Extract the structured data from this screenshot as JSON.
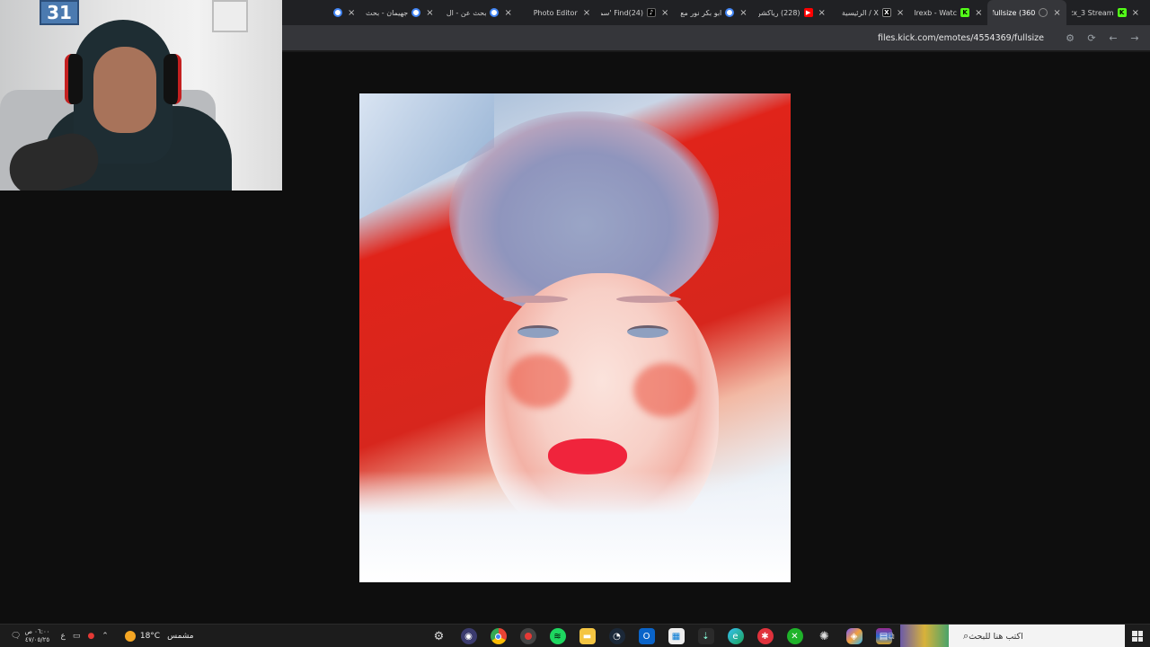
{
  "browser": {
    "tabs": [
      {
        "title": "rzx_3 Stream",
        "favicon": "kick",
        "active": false
      },
      {
        "title": "fullsize (360",
        "favicon": "none",
        "active": true
      },
      {
        "title": "llrexb - Watc",
        "favicon": "kick",
        "active": false
      },
      {
        "title": "X / الرئيسية",
        "favicon": "x",
        "active": false
      },
      {
        "title": "(228) رياكشن",
        "favicon": "yt",
        "active": false
      },
      {
        "title": "ابو بكر نور مع",
        "favicon": "google",
        "active": false
      },
      {
        "title": "(24)Find 'سمر",
        "favicon": "tiktok",
        "active": false
      },
      {
        "title": "Photo Editor",
        "favicon": "photo",
        "active": false
      },
      {
        "title": "بحث عن - ال",
        "favicon": "google",
        "active": false
      },
      {
        "title": "جهيمان - بحث",
        "favicon": "google",
        "active": false
      },
      {
        "title": "",
        "favicon": "google",
        "active": false
      }
    ],
    "address": {
      "url": "files.kick.com/emotes/4554369/fullsize"
    }
  },
  "webcam": {
    "poster_text": "31"
  },
  "taskbar": {
    "clock": {
      "time": "٠٦:٠٠ ص",
      "date": "٤٧/٠٥/٢٥"
    },
    "lang": "ع",
    "weather": {
      "temp": "18°C",
      "condition": "مشمس"
    },
    "apps": [
      "settings",
      "obs",
      "chrome",
      "recorder",
      "spotify",
      "files",
      "steam",
      "outlook",
      "store",
      "terminal",
      "edge",
      "app-red",
      "xbox",
      "steelseries",
      "copilot",
      "winrar"
    ],
    "search_placeholder": "اكتب هنا للبحث"
  }
}
